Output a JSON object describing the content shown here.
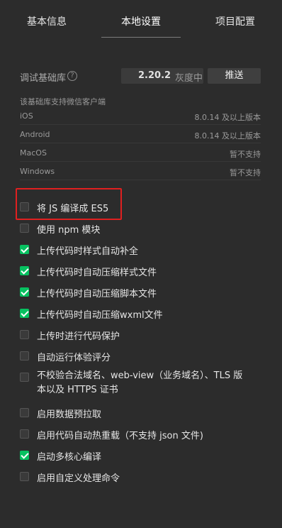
{
  "tabs": [
    "基本信息",
    "本地设置",
    "项目配置"
  ],
  "lib": {
    "label": "调试基础库",
    "version": "2.20.2",
    "version_desc": "灰度中",
    "push_label": "推送"
  },
  "support": {
    "title": "该基础库支持微信客户端",
    "clients": [
      {
        "name": "iOS",
        "value": "8.0.14 及以上版本"
      },
      {
        "name": "Android",
        "value": "8.0.14 及以上版本"
      },
      {
        "name": "MacOS",
        "value": "暂不支持"
      },
      {
        "name": "Windows",
        "value": "暂不支持"
      }
    ]
  },
  "options": [
    {
      "label": "将 JS 编译成 ES5",
      "checked": false
    },
    {
      "label": "使用 npm 模块",
      "checked": false
    },
    {
      "label": "上传代码时样式自动补全",
      "checked": true
    },
    {
      "label": "上传代码时自动压缩样式文件",
      "checked": true
    },
    {
      "label": "上传代码时自动压缩脚本文件",
      "checked": true
    },
    {
      "label": "上传代码时自动压缩wxml文件",
      "checked": true
    },
    {
      "label": "上传时进行代码保护",
      "checked": false
    },
    {
      "label": "自动运行体验评分",
      "checked": false
    },
    {
      "label": "不校验合法域名、web-view（业务域名）、TLS 版本以及 HTTPS 证书",
      "checked": false
    },
    {
      "label": "启用数据预拉取",
      "checked": false
    },
    {
      "label": "启用代码自动热重载（不支持 json 文件)",
      "checked": false
    },
    {
      "label": "启动多核心编译",
      "checked": true
    },
    {
      "label": "启用自定义处理命令",
      "checked": false
    }
  ],
  "colors": {
    "accent": "#07c160",
    "highlight": "#e02020",
    "background": "#2c2c2c"
  }
}
